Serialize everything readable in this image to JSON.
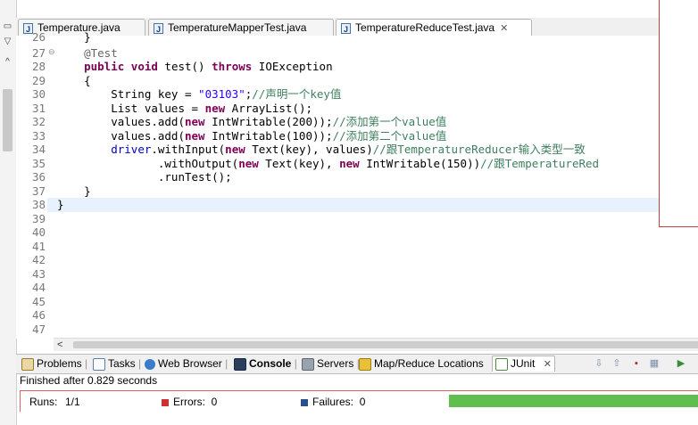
{
  "tabs": [
    {
      "label": "Temperature.java",
      "active": false
    },
    {
      "label": "TemperatureMapperTest.java",
      "active": false
    },
    {
      "label": "TemperatureReduceTest.java",
      "active": true
    }
  ],
  "editor": {
    "line_numbers": [
      "26",
      "27",
      "28",
      "29",
      "30",
      "31",
      "32",
      "33",
      "34",
      "35",
      "36",
      "37",
      "38",
      "39",
      "40",
      "41",
      "42",
      "43",
      "44",
      "45",
      "46",
      "47"
    ],
    "current_line": "38"
  },
  "views": [
    {
      "label": "Problems",
      "icon": "problems-icon"
    },
    {
      "label": "Tasks",
      "icon": "tasks-icon"
    },
    {
      "label": "Web Browser",
      "icon": "globe-icon"
    },
    {
      "label": "Console",
      "icon": "console-icon"
    },
    {
      "label": "Servers",
      "icon": "servers-icon"
    },
    {
      "label": "Map/Reduce Locations",
      "icon": "elephant-icon"
    },
    {
      "label": "JUnit",
      "icon": "junit-icon",
      "active": true
    }
  ],
  "junit": {
    "finished": "Finished after 0.829 seconds",
    "runs_label": "Runs:",
    "runs_value": "1/1",
    "errors_label": "Errors:",
    "errors_value": "0",
    "failures_label": "Failures:",
    "failures_value": "0",
    "status_color": "#5fbf4e",
    "progress": 1.0
  },
  "colors": {
    "keyword": "#7f0055",
    "string": "#2a00ff",
    "comment": "#3f7f5f",
    "field": "#0000c0"
  }
}
